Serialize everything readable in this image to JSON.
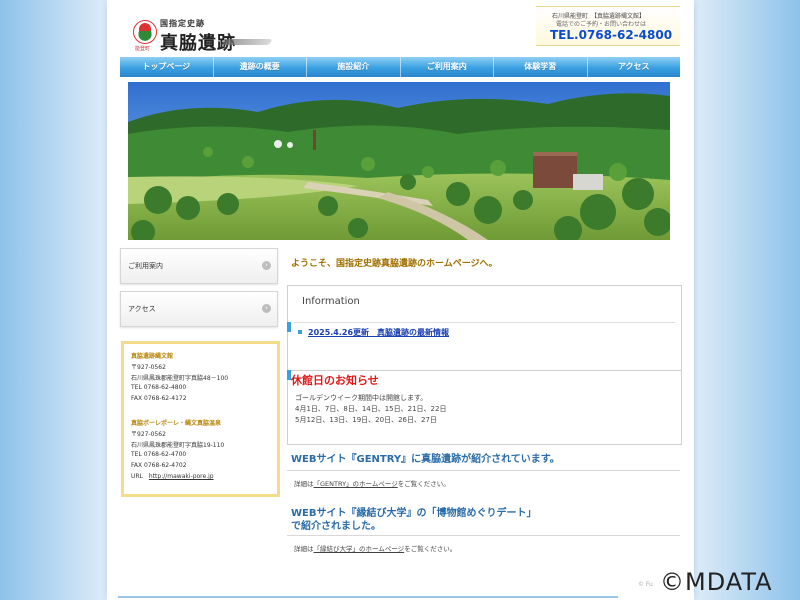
{
  "header": {
    "logo_small": "国指定史跡",
    "logo_big": "真脇遺跡",
    "logo_town": "能登町",
    "contact_line1": "石川県能登町　【真脇遺跡縄文館】",
    "contact_line2": "電話でのご予約・お問い合わせは",
    "tel": "TEL.0768-62-4800"
  },
  "nav": [
    "トップページ",
    "遺跡の概要",
    "施設紹介",
    "ご利用案内",
    "体験学習",
    "アクセス"
  ],
  "sidebar": {
    "menu": [
      {
        "label": "ご利用案内",
        "icon": "chevron-circle-icon"
      },
      {
        "label": "アクセス",
        "icon": "chevron-circle-icon"
      }
    ],
    "info": {
      "museum_title": "真脇遺跡縄文館",
      "museum_lines": [
        "〒927-0562",
        "石川県鳳珠郡能登町字真脇48－100",
        "TEL 0768-62-4800",
        "FAX 0768-62-4172"
      ],
      "onsen_title": "真脇ポーレポーレ・縄文真脇温泉",
      "onsen_lines": [
        "〒927-0562",
        "石川県鳳珠郡能登町字真脇19-110",
        "TEL 0768-62-4700",
        "FAX 0768-62-4702"
      ],
      "url_label": "URL",
      "url": "http://mawaki-pore.jp"
    }
  },
  "main": {
    "welcome": "ようこそ、国指定史跡真脇遺跡のホームページへ。",
    "info_heading": "Information",
    "news_link": "2025.4.26更新　真脇遺跡の最新情報",
    "closed_title": "休館日のお知らせ",
    "closed_lines": [
      "ゴールデンウイーク期間中は開館します。",
      "4月1日、7日、8日、14日、15日、21日、22日",
      "5月12日、13日、19日、20日、26日、27日"
    ],
    "gentry_title": "WEBサイト『GENTRY』に真脇遺跡が紹介されています。",
    "gentry_detail_prefix": "詳細は",
    "gentry_link": "「GENTRY」のホームページ",
    "gentry_detail_suffix": "をご覧ください。",
    "enmusubi_title_1": "WEBサイト『縁結び大学』の「博物館めぐりデート」",
    "enmusubi_title_2": "で紹介されました。",
    "enmusubi_detail_prefix": "詳細は",
    "enmusubi_link": "「縁結び大学」のホームページ",
    "enmusubi_detail_suffix": "をご覧ください。"
  },
  "footer": {
    "watermark_small": "© Fu",
    "watermark": "©MDATA"
  }
}
